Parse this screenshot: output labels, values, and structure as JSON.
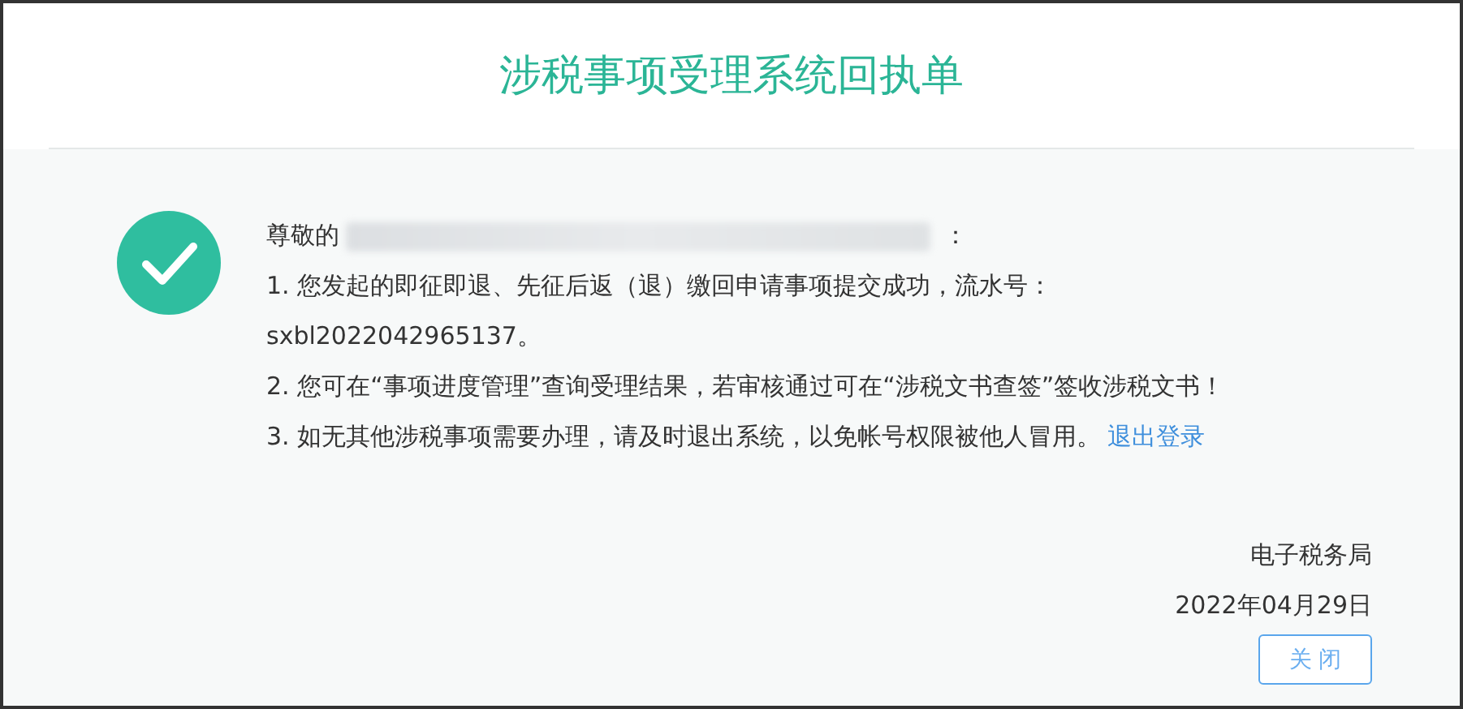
{
  "title": "涉税事项受理系统回执单",
  "greeting": {
    "prefix": "尊敬的",
    "suffix": "："
  },
  "items": [
    {
      "text": "1. 您发起的即征即退、先征后返（退）缴回申请事项提交成功，流水号：sxbl2022042965137。"
    },
    {
      "text": "2. 您可在“事项进度管理”查询受理结果，若审核通过可在“涉税文书查签”签收涉税文书！"
    },
    {
      "text": "3. 如无其他涉税事项需要办理，请及时退出系统，以免帐号权限被他人冒用。",
      "link": "退出登录"
    }
  ],
  "issuer": "电子税务局",
  "date": "2022年04月29日",
  "close_button": "关 闭"
}
